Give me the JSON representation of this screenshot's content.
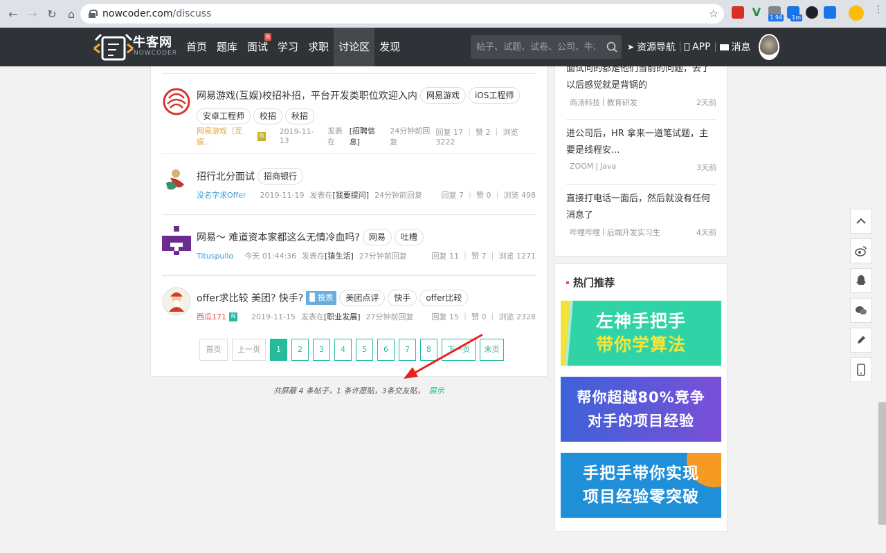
{
  "browser": {
    "url_domain": "nowcoder.com",
    "url_path": "/discuss",
    "ext_badges": [
      "1.94",
      "1m"
    ]
  },
  "header": {
    "logo_text": "牛客网",
    "logo_sub": "NOWCODER",
    "nav": [
      {
        "label": "首页"
      },
      {
        "label": "题库"
      },
      {
        "label": "面试",
        "badge": "N"
      },
      {
        "label": "学习"
      },
      {
        "label": "求职"
      },
      {
        "label": "讨论区",
        "active": true
      },
      {
        "label": "发现"
      }
    ],
    "search_placeholder": "帖子、试题、试卷、公司、牛友",
    "links": {
      "guide": "资源导航",
      "app": "APP",
      "messages": "消息"
    }
  },
  "posts": [
    {
      "title": "网易游戏(互娱)校招补招，平台开发类职位欢迎入内",
      "tags": [
        "网易游戏",
        "iOS工程师",
        "安卓工程师",
        "校招",
        "秋招"
      ],
      "author": "网易游戏（互娱...",
      "author_color": "#e8a33a",
      "badge": "N",
      "badge_color": "#c7b22b",
      "date": "2019-11-13",
      "posted_in_label": "发表在",
      "board": "[招聘信息]",
      "last_reply": "24分钟前回复",
      "stats": "回复 17 ｜ 赞 2 ｜ 浏览 3222"
    },
    {
      "title": "招行北分面试",
      "tags": [
        "招商银行"
      ],
      "author": "没名字求Offer",
      "author_color": "#3a9bd5",
      "date": "2019-11-19",
      "posted_in_label": "发表在",
      "board": "[我要提问]",
      "last_reply": "24分钟前回复",
      "stats": "回复 7 ｜ 赞 0 ｜ 浏览 498"
    },
    {
      "title": "网易～ 难道资本家都这么无情冷血吗?",
      "tags": [
        "网易",
        "吐槽"
      ],
      "author": "Tituspullo",
      "author_color": "#3a9bd5",
      "date": "今天 01:44:36",
      "posted_in_label": "发表在",
      "board": "[猿生活]",
      "last_reply": "27分钟前回复",
      "stats": "回复 11 ｜ 赞 7 ｜ 浏览 1271"
    },
    {
      "title": "offer求比较 美团? 快手?",
      "vote_label": "投票",
      "tags": [
        "美团点评",
        "快手",
        "offer比较"
      ],
      "author": "西瓜171",
      "author_color": "#e2564b",
      "badge": "N",
      "badge_color": "#25bb9b",
      "date": "2019-11-15",
      "posted_in_label": "发表在",
      "board": "[职业发展]",
      "last_reply": "27分钟前回复",
      "stats": "回复 15 ｜ 赞 0 ｜ 浏览 2328"
    }
  ],
  "pagination": {
    "first": "首页",
    "prev": "上一页",
    "pages": [
      "1",
      "2",
      "3",
      "4",
      "5",
      "6",
      "7",
      "8"
    ],
    "current": "1",
    "next": "下一页",
    "last": "末页"
  },
  "shield_note": {
    "text": "共屏蔽 4 条帖子，1 条许愿贴，3条交友贴，",
    "show": "展示"
  },
  "related": [
    {
      "title": "面试问的都是他们当前的问题，去了以后感觉就是背锅的",
      "company": "商汤科技",
      "role": "教育研发",
      "age": "2天前"
    },
    {
      "title": "进公司后，HR 拿来一道笔试题，主要是线程安...",
      "company": "ZOOM",
      "role": "Java",
      "age": "3天前"
    },
    {
      "title": "直接打电话一面后，然后就没有任何消息了",
      "company": "哔哩哔哩",
      "role": "后端开发实习生",
      "age": "4天前"
    }
  ],
  "hot": {
    "title": "热门推荐",
    "banners": [
      {
        "line1": "左神手把手",
        "line2": "带你学算法",
        "bg": "#2fd3a5",
        "line1_color": "#ffffff",
        "line2_color": "#f6e63a"
      },
      {
        "line1": "帮你超越80%竞争",
        "line2": "对手的项目经验",
        "bg": "#5b4fd6",
        "line1_color": "#ffffff",
        "line2_color": "#ffffff"
      },
      {
        "line1": "手把手带你实现",
        "line2": "项目经验零突破",
        "bg": "#1f8fd8",
        "line1_color": "#ffffff",
        "line2_color": "#ffffff"
      }
    ]
  },
  "side_tools": [
    "arrow-up-icon",
    "weibo-icon",
    "qq-icon",
    "wechat-icon",
    "pencil-icon",
    "mobile-icon"
  ],
  "colors": {
    "accent": "#25bb9b",
    "header_bg": "#2f3337"
  }
}
